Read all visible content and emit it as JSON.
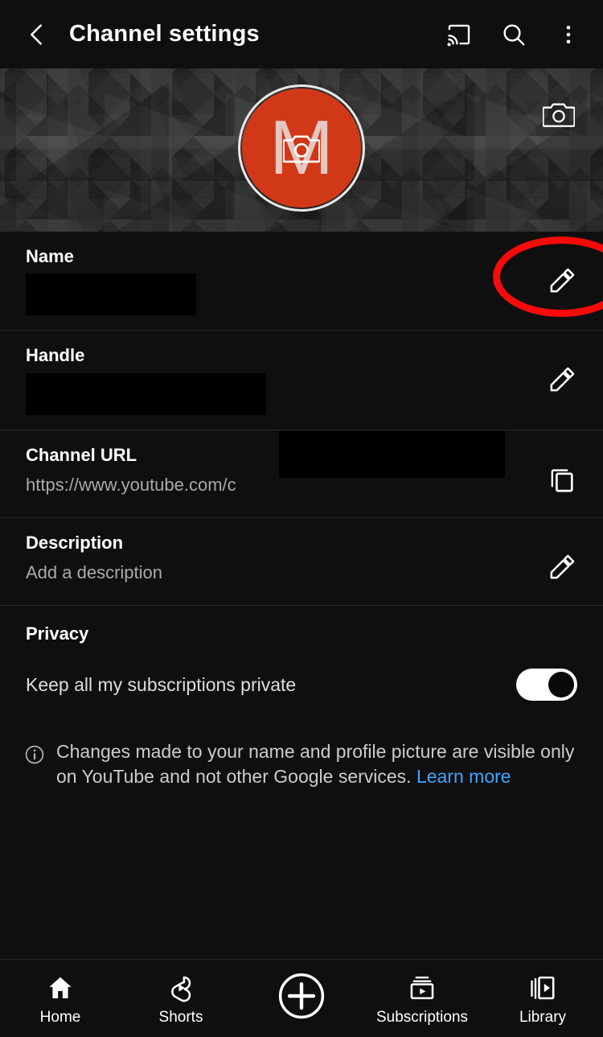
{
  "appbar": {
    "back_icon": "back-chevron-icon",
    "title": "Channel settings",
    "cast_icon": "cast-icon",
    "search_icon": "search-icon",
    "more_icon": "more-vertical-icon"
  },
  "banner": {
    "edit_camera_icon": "camera-icon",
    "avatar": {
      "letter": "M",
      "color": "#d13818",
      "camera_icon": "camera-icon"
    }
  },
  "settings": {
    "name": {
      "label": "Name",
      "value": "",
      "redacted": true,
      "action_icon": "pencil-icon"
    },
    "handle": {
      "label": "Handle",
      "value": "",
      "redacted": true,
      "action_icon": "pencil-icon"
    },
    "channel_url": {
      "label": "Channel URL",
      "value": "https://www.youtube.com/c",
      "redacted": true,
      "action_icon": "copy-icon"
    },
    "description": {
      "label": "Description",
      "value": "Add a description",
      "action_icon": "pencil-icon"
    },
    "privacy": {
      "label": "Privacy",
      "toggle_label": "Keep all my subscriptions private",
      "toggle_state": "on"
    }
  },
  "note": {
    "icon": "info-icon",
    "text": "Changes made to your name and profile picture are visible only on YouTube and not other Google services.",
    "link": "Learn more",
    "link_color": "#3ea6ff"
  },
  "annotation": {
    "shape": "ellipse",
    "color": "#f70a0a",
    "target": "name-edit-pencil"
  },
  "bottom_nav": [
    {
      "label": "Home",
      "icon": "home-icon"
    },
    {
      "label": "Shorts",
      "icon": "shorts-icon"
    },
    {
      "label": "",
      "icon": "create-plus-icon"
    },
    {
      "label": "Subscriptions",
      "icon": "subscriptions-icon"
    },
    {
      "label": "Library",
      "icon": "library-icon"
    }
  ]
}
